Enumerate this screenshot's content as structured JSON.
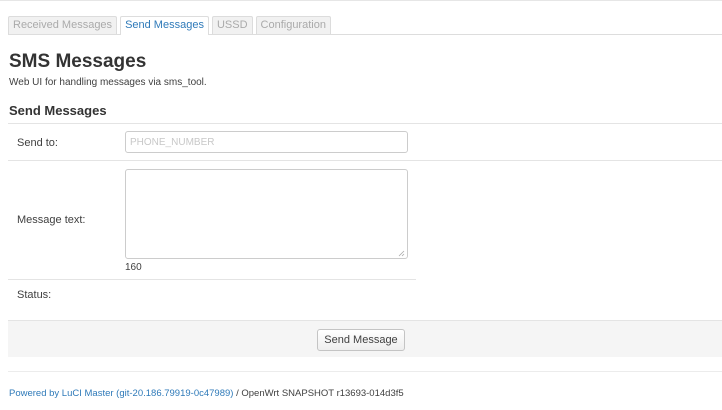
{
  "tabs": [
    {
      "label": "Received Messages",
      "active": false
    },
    {
      "label": "Send Messages",
      "active": true
    },
    {
      "label": "USSD",
      "active": false
    },
    {
      "label": "Configuration",
      "active": false
    }
  ],
  "page": {
    "title": "SMS Messages",
    "description": "Web UI for handling messages via sms_tool."
  },
  "section": {
    "title": "Send Messages"
  },
  "form": {
    "send_to_label": "Send to:",
    "send_to_placeholder": "PHONE_NUMBER",
    "send_to_value": "",
    "message_label": "Message text:",
    "message_value": "",
    "char_counter": "160",
    "status_label": "Status:",
    "status_value": ""
  },
  "actions": {
    "send_label": "Send Message"
  },
  "footer": {
    "link_text": "Powered by LuCI Master (git-20.186.79919-0c47989)",
    "separator": " / ",
    "version_text": "OpenWrt SNAPSHOT r13693-014d3f5"
  },
  "colors": {
    "accent": "#2f7ab9",
    "text": "#404040",
    "heading": "#333333"
  }
}
